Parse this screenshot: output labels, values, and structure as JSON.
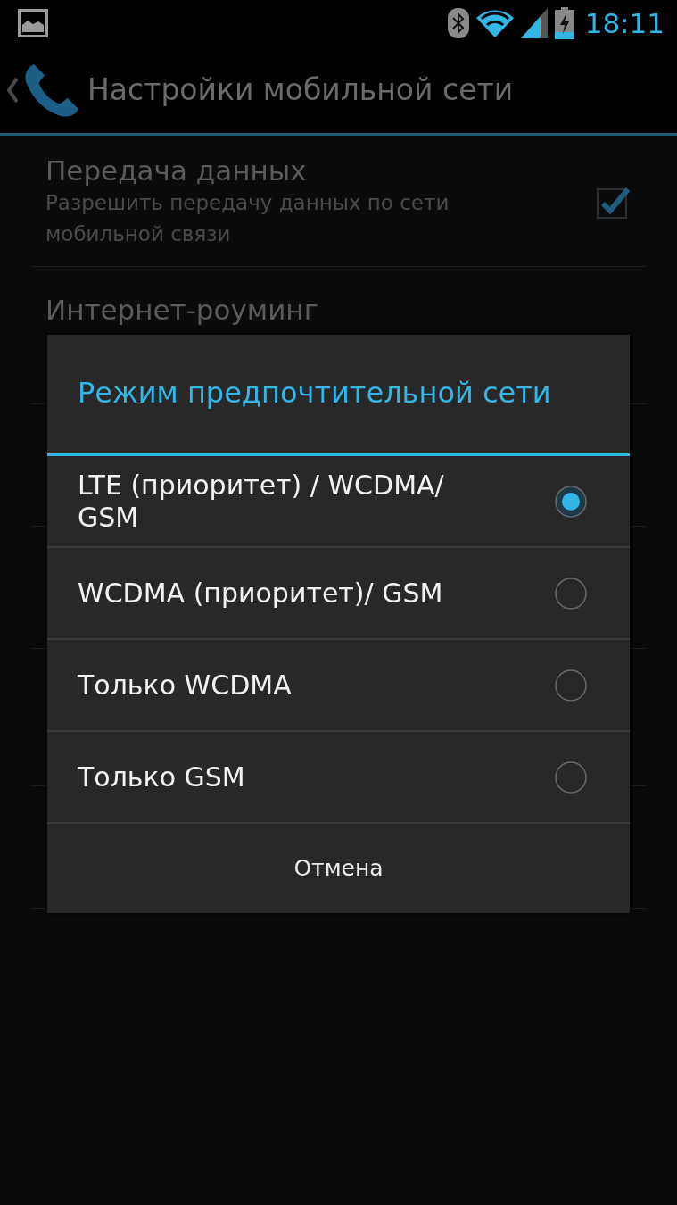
{
  "status_bar": {
    "time": "18:11"
  },
  "action_bar": {
    "title": "Настройки мобильной сети"
  },
  "settings": [
    {
      "title": "Передача данных",
      "summary": "Разрешить передачу данных по сети мобильной связи",
      "checked": true
    },
    {
      "title": "Интернет-роуминг"
    }
  ],
  "dialog": {
    "title": "Режим предпочтительной сети",
    "options": [
      {
        "label": "LTE (приоритет) / WCDMA/ GSM",
        "selected": true
      },
      {
        "label": "WCDMA (приоритет)/ GSM",
        "selected": false
      },
      {
        "label": "Только WCDMA",
        "selected": false
      },
      {
        "label": "Только GSM",
        "selected": false
      }
    ],
    "cancel": "Отмена"
  }
}
